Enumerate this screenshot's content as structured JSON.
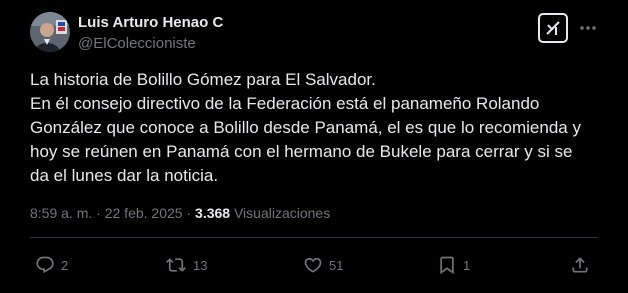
{
  "author": {
    "display_name": "Luis Arturo Henao C",
    "handle": "@ElColeccioniste"
  },
  "icons": {
    "grok": "grok-icon",
    "more": "more-icon",
    "reply": "reply-icon",
    "retweet": "retweet-icon",
    "like": "like-icon",
    "bookmark": "bookmark-icon",
    "share": "share-icon"
  },
  "tweet": {
    "lines": [
      "La historia de Bolillo Gómez para El Salvador.",
      "En él consejo directivo de la Federación está el panameño Rolando",
      "González que conoce a Bolillo desde Panamá, el es que lo recomienda y",
      "hoy se reúnen en Panamá con el hermano de Bukele para cerrar y si se",
      "da el lunes dar la noticia."
    ]
  },
  "meta": {
    "time": "8:59 a. m.",
    "separator": " · ",
    "date": "22 feb. 2025",
    "views_count": "3.368",
    "views_label": "Visualizaciones"
  },
  "actions": {
    "replies": "2",
    "retweets": "13",
    "likes": "51",
    "bookmarks": "1"
  },
  "colors": {
    "background": "#000000",
    "text": "#e7e9ea",
    "secondary": "#71767b",
    "divider": "#2f3336"
  }
}
